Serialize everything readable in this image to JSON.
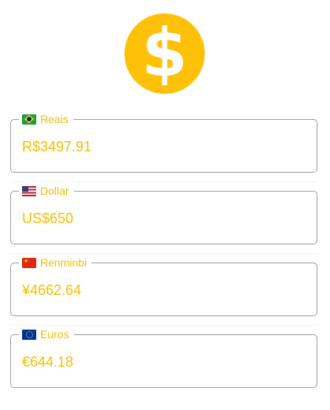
{
  "logo": {
    "glyph": "$",
    "icon": "dollar-coin-icon",
    "color": "#FFC107"
  },
  "accent_color": "#F6BE00",
  "fields": [
    {
      "flag": "brazil-flag-icon",
      "label": "Reais",
      "value": "R$3497.91"
    },
    {
      "flag": "usa-flag-icon",
      "label": "Dollar",
      "value": "US$650"
    },
    {
      "flag": "china-flag-icon",
      "label": "Renminbi",
      "value": "¥4662.64"
    },
    {
      "flag": "eu-flag-icon",
      "label": "Euros",
      "value": "€644.18"
    }
  ]
}
